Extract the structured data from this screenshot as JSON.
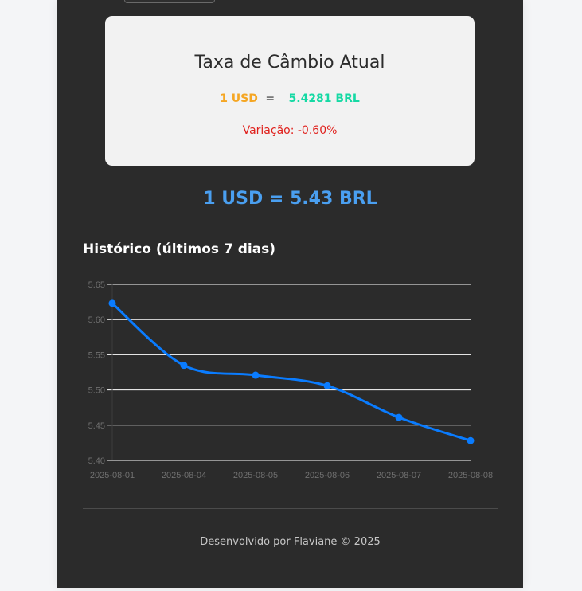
{
  "card": {
    "title": "Taxa de Câmbio Atual",
    "usd_label": "1 USD",
    "equals": "=",
    "brl_label": "5.4281 BRL",
    "variation": "Variação: -0.60%"
  },
  "summary": "1 USD = 5.43 BRL",
  "history": {
    "title": "Histórico (últimos 7 dias)"
  },
  "chart_data": {
    "type": "line",
    "x": [
      "2025-08-01",
      "2025-08-04",
      "2025-08-05",
      "2025-08-06",
      "2025-08-07",
      "2025-08-08"
    ],
    "series": [
      {
        "values": [
          5.623,
          5.535,
          5.521,
          5.506,
          5.461,
          5.428
        ],
        "color": "#0a7cff"
      }
    ],
    "ylim": [
      5.4,
      5.65
    ],
    "yticks": [
      "5.65",
      "5.60",
      "5.55",
      "5.50",
      "5.45",
      "5.40"
    ],
    "grid": true,
    "title": "",
    "xlabel": "",
    "ylabel": ""
  },
  "footer": "Desenvolvido por Flaviane © 2025",
  "colors": {
    "panel": "#2b2b2b",
    "card": "#f2f2f2",
    "usd": "#f5a623",
    "brl": "#16d9a4",
    "variation": "#e0201c",
    "summary": "#4a9ff0",
    "line": "#0a7cff"
  }
}
